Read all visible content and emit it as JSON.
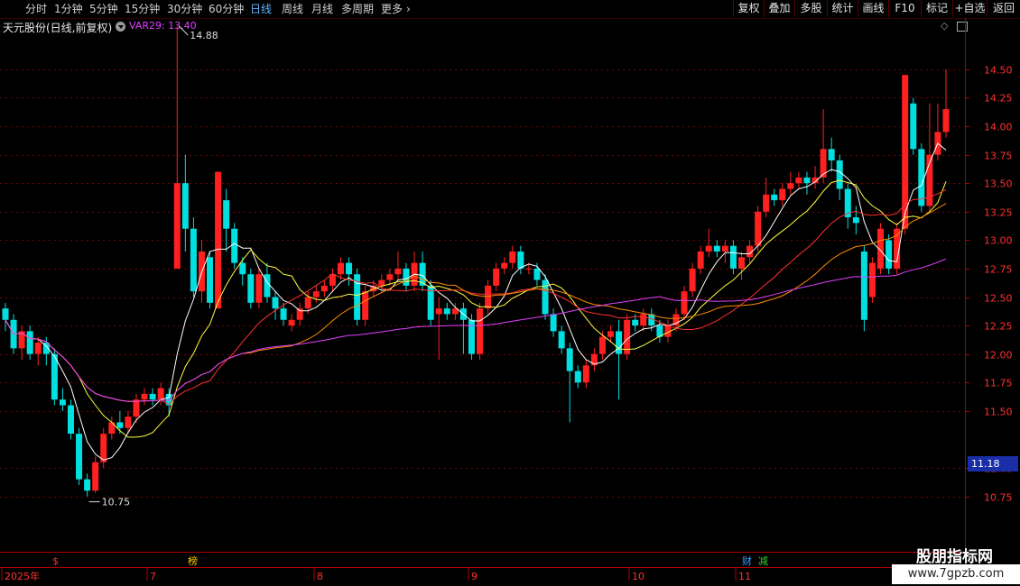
{
  "toolbar": {
    "periods": [
      "分时",
      "1分钟",
      "5分钟",
      "15分钟",
      "30分钟",
      "60分钟",
      "日线",
      "周线",
      "月线",
      "多周期",
      "更多"
    ],
    "active_period": "日线",
    "right_buttons": [
      "复权",
      "叠加",
      "多股",
      "统计",
      "画线",
      "F10",
      "标记",
      "+自选",
      "返回"
    ]
  },
  "info": {
    "stock_title": "天元股份(日线,前复权)",
    "indicator": "VAR29: 13.40"
  },
  "price_box": "11.18",
  "annotations": {
    "high_label": "14.88",
    "low_label": "10.75"
  },
  "markers": [
    {
      "text": "$",
      "color": "#ff3030"
    },
    {
      "text": "榜",
      "color": "#ffcc00"
    },
    {
      "text": "财",
      "color": "#30a0ff"
    },
    {
      "text": "减",
      "color": "#30d030"
    }
  ],
  "watermark": {
    "line1": "股朋指标网",
    "line2": "www.7gpzb.com"
  },
  "colors": {
    "up": "#ff2020",
    "down": "#00e0e0",
    "grid": "#7a0000",
    "axis": "#b00000",
    "ma5": "#ffffff",
    "ma10": "#ffff40",
    "ma20": "#ff3030",
    "ma30": "#ff8c00",
    "ma60": "#e040ff"
  },
  "chart_data": {
    "type": "candlestick",
    "y_axis_ticks": [
      "14.50",
      "14.25",
      "14.00",
      "13.75",
      "13.50",
      "13.25",
      "13.00",
      "12.75",
      "12.50",
      "12.25",
      "12.00",
      "11.75",
      "11.50",
      "11.00",
      "10.75"
    ],
    "ylim": [
      10.6,
      15.0
    ],
    "x_axis_labels": [
      "2025年",
      "7",
      "8",
      "9",
      "10",
      "11"
    ],
    "candles": [
      [
        12.4,
        12.3,
        12.45,
        12.2
      ],
      [
        12.3,
        12.05,
        12.35,
        12.0
      ],
      [
        12.05,
        12.2,
        12.25,
        11.95
      ],
      [
        12.2,
        12.0,
        12.25,
        11.95
      ],
      [
        12.0,
        12.1,
        12.15,
        11.9
      ],
      [
        12.1,
        12.0,
        12.15,
        11.9
      ],
      [
        12.0,
        11.6,
        12.05,
        11.55
      ],
      [
        11.6,
        11.55,
        11.7,
        11.5
      ],
      [
        11.55,
        11.3,
        11.6,
        11.25
      ],
      [
        11.3,
        10.9,
        11.35,
        10.85
      ],
      [
        10.9,
        10.8,
        10.95,
        10.75
      ],
      [
        10.8,
        11.05,
        11.1,
        10.78
      ],
      [
        11.05,
        11.3,
        11.35,
        11.0
      ],
      [
        11.3,
        11.4,
        11.45,
        11.25
      ],
      [
        11.4,
        11.35,
        11.5,
        11.3
      ],
      [
        11.35,
        11.45,
        11.5,
        11.3
      ],
      [
        11.45,
        11.6,
        11.65,
        11.4
      ],
      [
        11.6,
        11.65,
        11.7,
        11.55
      ],
      [
        11.65,
        11.6,
        11.7,
        11.55
      ],
      [
        11.6,
        11.7,
        11.75,
        11.55
      ],
      [
        11.65,
        11.55,
        11.7,
        11.45
      ],
      [
        12.75,
        13.5,
        14.88,
        12.75
      ],
      [
        13.5,
        13.1,
        13.75,
        12.9
      ],
      [
        13.1,
        12.55,
        13.2,
        12.5
      ],
      [
        12.55,
        12.9,
        13.0,
        12.45
      ],
      [
        12.85,
        12.45,
        12.9,
        12.4
      ],
      [
        12.4,
        13.6,
        13.6,
        12.4
      ],
      [
        13.35,
        13.1,
        13.45,
        12.9
      ],
      [
        13.1,
        12.8,
        13.15,
        12.75
      ],
      [
        12.8,
        12.7,
        12.85,
        12.6
      ],
      [
        12.7,
        12.45,
        12.75,
        12.4
      ],
      [
        12.45,
        12.7,
        12.75,
        12.4
      ],
      [
        12.7,
        12.5,
        12.8,
        12.45
      ],
      [
        12.5,
        12.4,
        12.55,
        12.3
      ],
      [
        12.4,
        12.3,
        12.45,
        12.25
      ],
      [
        12.25,
        12.3,
        12.35,
        12.2
      ],
      [
        12.3,
        12.4,
        12.45,
        12.25
      ],
      [
        12.4,
        12.5,
        12.55,
        12.35
      ],
      [
        12.5,
        12.55,
        12.6,
        12.45
      ],
      [
        12.55,
        12.6,
        12.65,
        12.5
      ],
      [
        12.6,
        12.7,
        12.75,
        12.55
      ],
      [
        12.7,
        12.8,
        12.85,
        12.65
      ],
      [
        12.8,
        12.7,
        12.85,
        12.6
      ],
      [
        12.7,
        12.3,
        12.75,
        12.25
      ],
      [
        12.3,
        12.55,
        12.6,
        12.25
      ],
      [
        12.55,
        12.6,
        12.65,
        12.5
      ],
      [
        12.6,
        12.65,
        12.7,
        12.55
      ],
      [
        12.65,
        12.7,
        12.75,
        12.6
      ],
      [
        12.7,
        12.75,
        12.9,
        12.65
      ],
      [
        12.75,
        12.6,
        12.8,
        12.55
      ],
      [
        12.6,
        12.8,
        12.9,
        12.55
      ],
      [
        12.8,
        12.6,
        12.9,
        12.55
      ],
      [
        12.6,
        12.3,
        12.65,
        12.25
      ],
      [
        12.35,
        12.4,
        12.5,
        11.95
      ],
      [
        12.4,
        12.35,
        12.45,
        12.3
      ],
      [
        12.35,
        12.4,
        12.45,
        12.3
      ],
      [
        12.4,
        12.3,
        12.45,
        12.0
      ],
      [
        12.3,
        12.0,
        12.35,
        11.95
      ],
      [
        12.0,
        12.4,
        12.45,
        11.95
      ],
      [
        12.4,
        12.6,
        12.65,
        12.35
      ],
      [
        12.6,
        12.75,
        12.8,
        12.55
      ],
      [
        12.75,
        12.8,
        12.85,
        12.7
      ],
      [
        12.8,
        12.9,
        12.95,
        12.75
      ],
      [
        12.9,
        12.75,
        12.95,
        12.7
      ],
      [
        12.75,
        12.75,
        12.8,
        12.7
      ],
      [
        12.75,
        12.65,
        12.8,
        12.6
      ],
      [
        12.65,
        12.35,
        12.7,
        12.3
      ],
      [
        12.35,
        12.2,
        12.4,
        12.15
      ],
      [
        12.2,
        12.05,
        12.25,
        12.0
      ],
      [
        12.05,
        11.85,
        12.1,
        11.4
      ],
      [
        11.85,
        11.75,
        11.9,
        11.7
      ],
      [
        11.75,
        11.9,
        11.95,
        11.7
      ],
      [
        11.9,
        12.0,
        12.05,
        11.85
      ],
      [
        12.0,
        12.15,
        12.2,
        11.95
      ],
      [
        12.15,
        12.2,
        12.25,
        12.1
      ],
      [
        12.2,
        12.0,
        12.3,
        11.6
      ],
      [
        12.0,
        12.3,
        12.35,
        11.95
      ],
      [
        12.3,
        12.25,
        12.35,
        12.2
      ],
      [
        12.25,
        12.35,
        12.4,
        12.2
      ],
      [
        12.35,
        12.25,
        12.4,
        12.2
      ],
      [
        12.25,
        12.15,
        12.3,
        12.1
      ],
      [
        12.15,
        12.25,
        12.3,
        12.1
      ],
      [
        12.25,
        12.35,
        12.4,
        12.2
      ],
      [
        12.35,
        12.55,
        12.6,
        12.3
      ],
      [
        12.55,
        12.75,
        12.8,
        12.5
      ],
      [
        12.75,
        12.9,
        12.95,
        12.7
      ],
      [
        12.9,
        12.95,
        13.1,
        12.85
      ],
      [
        12.95,
        12.9,
        13.0,
        12.85
      ],
      [
        12.9,
        12.95,
        13.0,
        12.8
      ],
      [
        12.95,
        12.75,
        13.0,
        12.7
      ],
      [
        12.75,
        12.85,
        12.9,
        12.65
      ],
      [
        12.85,
        12.95,
        13.0,
        12.8
      ],
      [
        12.95,
        13.25,
        13.3,
        12.9
      ],
      [
        13.25,
        13.4,
        13.55,
        13.2
      ],
      [
        13.4,
        13.35,
        13.45,
        13.3
      ],
      [
        13.35,
        13.45,
        13.5,
        13.3
      ],
      [
        13.45,
        13.5,
        13.6,
        13.4
      ],
      [
        13.5,
        13.55,
        13.6,
        13.45
      ],
      [
        13.55,
        13.5,
        13.6,
        13.4
      ],
      [
        13.5,
        13.55,
        13.65,
        13.45
      ],
      [
        13.55,
        13.8,
        14.15,
        13.5
      ],
      [
        13.8,
        13.7,
        13.9,
        13.6
      ],
      [
        13.7,
        13.45,
        13.75,
        13.35
      ],
      [
        13.45,
        13.2,
        13.5,
        13.1
      ],
      [
        13.2,
        13.15,
        13.3,
        13.05
      ],
      [
        12.9,
        12.3,
        12.95,
        12.2
      ],
      [
        12.5,
        12.8,
        12.85,
        12.45
      ],
      [
        12.75,
        13.1,
        13.15,
        12.7
      ],
      [
        13.0,
        12.75,
        13.05,
        12.7
      ],
      [
        12.75,
        13.1,
        13.15,
        12.7
      ],
      [
        13.1,
        14.45,
        14.45,
        13.05
      ],
      [
        14.2,
        13.8,
        14.25,
        13.75
      ],
      [
        13.8,
        13.3,
        13.85,
        13.25
      ],
      [
        13.3,
        13.75,
        14.2,
        13.25
      ],
      [
        13.75,
        13.95,
        14.2,
        13.7
      ],
      [
        13.95,
        14.15,
        14.5,
        13.9
      ]
    ],
    "ma_series": [
      {
        "name": "VAR29",
        "values": []
      }
    ]
  }
}
